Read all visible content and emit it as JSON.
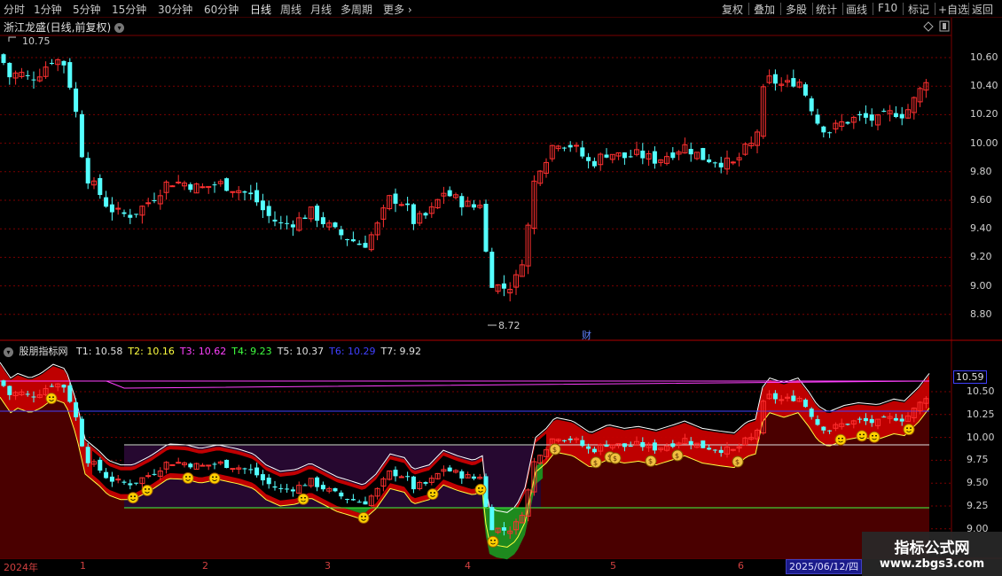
{
  "toolbar": {
    "left_items": [
      "分时",
      "1分钟",
      "5分钟",
      "15分钟",
      "30分钟",
      "60分钟",
      "日线",
      "周线",
      "月线",
      "多周期",
      "更多"
    ],
    "more_arrow": "›",
    "right_items": [
      "复权",
      "叠加",
      "多股",
      "统计",
      "画线",
      "F10",
      "标记",
      "+自选",
      "返回"
    ]
  },
  "title": "浙江龙盛(日线,前复权)",
  "main_chart": {
    "y_labels": [
      "10.60",
      "10.40",
      "10.20",
      "10.00",
      "9.80",
      "9.60",
      "9.40",
      "9.20",
      "9.00",
      "8.80"
    ],
    "high_marker": "10.75",
    "low_marker": "8.72",
    "cai_marker": "财"
  },
  "indicator": {
    "name": "股朋指标网",
    "items": [
      {
        "label": "T1: 10.58",
        "color": "#e0e0e0"
      },
      {
        "label": "T2: 10.16",
        "color": "#ffff40"
      },
      {
        "label": "T3: 10.62",
        "color": "#ff40ff"
      },
      {
        "label": "T4: 9.23",
        "color": "#40ff40"
      },
      {
        "label": "T5: 10.37",
        "color": "#e0e0e0"
      },
      {
        "label": "T6: 10.29",
        "color": "#4040ff"
      },
      {
        "label": "T7: 9.92",
        "color": "#e0e0e0"
      }
    ],
    "y_labels": [
      "10.50",
      "10.25",
      "10.00",
      "9.75",
      "9.50",
      "9.25",
      "9.00"
    ],
    "current_value": "10.59"
  },
  "x_axis": {
    "labels": [
      "2024年",
      "1",
      "2",
      "3",
      "4",
      "5",
      "6"
    ],
    "cursor_date": "2025/06/12/四"
  },
  "watermark": {
    "line1": "指标公式网",
    "line2": "www.zbgs3.com"
  },
  "colors": {
    "up": "#ff3030",
    "down": "#54ffff",
    "grid": "#7a0000",
    "band_red": "#d00000",
    "band_dark": "#5a0000",
    "purple": "#2a0a3a",
    "green": "#20a020"
  }
}
